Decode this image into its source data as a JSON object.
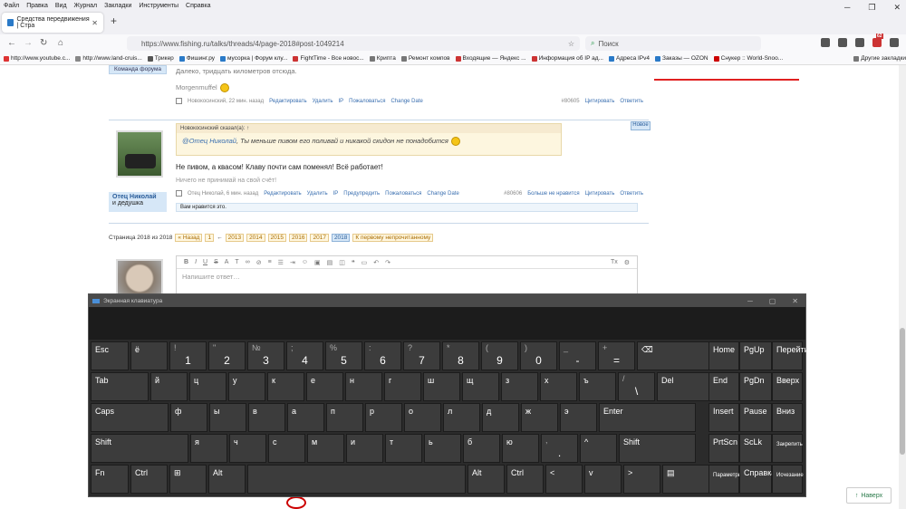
{
  "browser": {
    "menu": [
      "Файл",
      "Правка",
      "Вид",
      "Журнал",
      "Закладки",
      "Инструменты",
      "Справка"
    ],
    "tab_title": "Средства передвижения | Стра",
    "url": "https://www.fishing.ru/talks/threads/4/page-2018#post-1049214",
    "search_placeholder": "Поиск",
    "badge_count": "62",
    "bookmarks": [
      "http://www.youtube.c...",
      "http://www.land-cruis...",
      "Трикер",
      "Фишинг.ру",
      "мусорка | Форум клу...",
      "FightTime - Все новос...",
      "Крипта",
      "Ремонт компов",
      "Входящие — Яндекс ...",
      "Информация об IP ад...",
      "Адреса IPv4",
      "Заказы — OZON",
      "Снукер :: World-Snoo...",
      "Другие закладки"
    ]
  },
  "forum": {
    "team_badge": "Команда форума",
    "prev_text": "Далеко, тридцать километров отсюда.",
    "prev_sig": "Morgenmuffel",
    "prev_footer": {
      "meta": "Новокосинский, 22 мин. назад",
      "actions": [
        "Редактировать",
        "Удалить",
        "IP",
        "Пожаловаться",
        "Change Date"
      ],
      "post_no": "#80605",
      "right_actions": [
        "Цитировать",
        "Ответить"
      ]
    },
    "new_badge": "Новое",
    "user_name": "Отец Николай",
    "user_title": "и дедушка",
    "quote_head": "Новокосинский сказал(а): ↑",
    "quote_mention": "@Отец Николай",
    "quote_text": ", Ты меньше пивом его поливай и никакой скидон не понадобится",
    "main_text": "Не пивом, а квасом! Клаву почти сам поменял! Всё работает!",
    "sig2": "Ничего не принимай на свой счёт!",
    "post_footer": {
      "meta": "Отец Николай, 6 мин. назад",
      "actions": [
        "Редактировать",
        "Удалить",
        "IP",
        "Предупредить",
        "Пожаловаться",
        "Change Date"
      ],
      "post_no": "#80606",
      "right_actions": [
        "Больше не нравится",
        "Цитировать",
        "Ответить"
      ]
    },
    "likes": "Вам нравится это.",
    "pagination": {
      "label": "Страница 2018 из 2018",
      "back": "« Назад",
      "first": "1",
      "arrow": "←",
      "pages": [
        "2013",
        "2014",
        "2015",
        "2016",
        "2017"
      ],
      "current": "2018",
      "unread": "К первому непрочитанному"
    },
    "editor_placeholder": "Напишите ответ…",
    "back_to_top": "Наверх"
  },
  "keyboard": {
    "title": "Экранная клавиатура",
    "rows": [
      [
        [
          "Esc",
          "",
          ""
        ],
        [
          "ё",
          "",
          ""
        ],
        [
          "!",
          "1",
          ""
        ],
        [
          "\"",
          "2",
          ""
        ],
        [
          "№",
          "3",
          ""
        ],
        [
          ";",
          "4",
          ""
        ],
        [
          "%",
          "5",
          ""
        ],
        [
          ":",
          "6",
          ""
        ],
        [
          "?",
          "7",
          ""
        ],
        [
          "*",
          "8",
          ""
        ],
        [
          "(",
          "9",
          ""
        ],
        [
          ")",
          "0",
          ""
        ],
        [
          "_",
          "-",
          ""
        ],
        [
          "+",
          "=",
          ""
        ],
        [
          "⌫",
          "",
          ""
        ]
      ],
      [
        [
          "Tab",
          "",
          ""
        ],
        [
          "й",
          "",
          ""
        ],
        [
          "ц",
          "",
          ""
        ],
        [
          "у",
          "",
          ""
        ],
        [
          "к",
          "",
          ""
        ],
        [
          "е",
          "",
          ""
        ],
        [
          "н",
          "",
          ""
        ],
        [
          "г",
          "",
          ""
        ],
        [
          "ш",
          "",
          ""
        ],
        [
          "щ",
          "",
          ""
        ],
        [
          "з",
          "",
          ""
        ],
        [
          "х",
          "",
          ""
        ],
        [
          "ъ",
          "",
          ""
        ],
        [
          "/",
          "\\",
          ""
        ],
        [
          "Del",
          "",
          ""
        ]
      ],
      [
        [
          "Caps",
          "",
          ""
        ],
        [
          "ф",
          "",
          ""
        ],
        [
          "ы",
          "",
          ""
        ],
        [
          "в",
          "",
          ""
        ],
        [
          "а",
          "",
          ""
        ],
        [
          "п",
          "",
          ""
        ],
        [
          "р",
          "",
          ""
        ],
        [
          "о",
          "",
          ""
        ],
        [
          "л",
          "",
          ""
        ],
        [
          "д",
          "",
          ""
        ],
        [
          "ж",
          "",
          ""
        ],
        [
          "э",
          "",
          ""
        ],
        [
          "Enter",
          "",
          ""
        ]
      ],
      [
        [
          "Shift",
          "",
          ""
        ],
        [
          "я",
          "",
          ""
        ],
        [
          "ч",
          "",
          ""
        ],
        [
          "с",
          "",
          ""
        ],
        [
          "м",
          "",
          ""
        ],
        [
          "и",
          "",
          ""
        ],
        [
          "т",
          "",
          ""
        ],
        [
          "ь",
          "",
          ""
        ],
        [
          "б",
          "",
          ""
        ],
        [
          "ю",
          "",
          ""
        ],
        [
          ",",
          ".",
          ""
        ],
        [
          "^",
          "",
          ""
        ],
        [
          "Shift",
          "",
          ""
        ]
      ],
      [
        [
          "Fn",
          "",
          ""
        ],
        [
          "Ctrl",
          "",
          ""
        ],
        [
          "⊞",
          "",
          ""
        ],
        [
          "Alt",
          "",
          ""
        ],
        [
          "",
          "",
          ""
        ],
        [
          "Alt",
          "",
          ""
        ],
        [
          "Ctrl",
          "",
          ""
        ],
        [
          "<",
          "",
          ""
        ],
        [
          "v",
          "",
          ""
        ],
        [
          ">",
          "",
          ""
        ],
        [
          "▤",
          "",
          ""
        ]
      ]
    ],
    "side": [
      [
        "Home",
        "PgUp",
        "Перейти"
      ],
      [
        "End",
        "PgDn",
        "Вверх"
      ],
      [
        "Insert",
        "Pause",
        "Вниз"
      ],
      [
        "PrtScn",
        "ScLk",
        "Закрепить"
      ],
      [
        "Параметры",
        "Справка",
        "Исчезание"
      ]
    ]
  },
  "colors": {
    "accent": "#3a6fb0",
    "quote_bg": "#fdf6df",
    "red_line": "#e02020"
  }
}
